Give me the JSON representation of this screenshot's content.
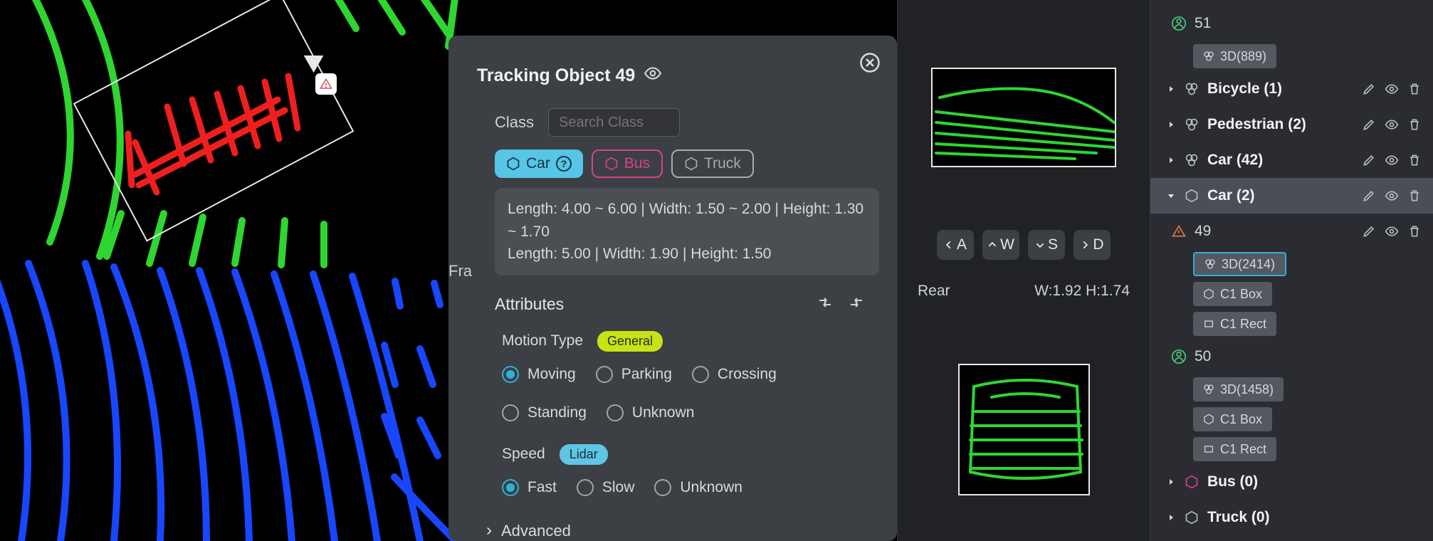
{
  "panel": {
    "title": "Tracking Object 49",
    "class_label": "Class",
    "search_placeholder": "Search Class",
    "classes": {
      "car": "Car",
      "bus": "Bus",
      "truck": "Truck"
    },
    "tooltip_line1": "Length: 4.00 ~ 6.00 | Width: 1.50 ~ 2.00 | Height: 1.30 ~ 1.70",
    "tooltip_line2": "Length: 5.00 | Width: 1.90 | Height: 1.50",
    "frame_cut": "Fra",
    "attributes_label": "Attributes",
    "motion": {
      "label": "Motion Type",
      "badge": "General",
      "options": [
        "Moving",
        "Parking",
        "Crossing",
        "Standing",
        "Unknown"
      ],
      "selected": "Moving"
    },
    "speed": {
      "label": "Speed",
      "badge": "Lidar",
      "options": [
        "Fast",
        "Slow",
        "Unknown"
      ],
      "selected": "Fast"
    },
    "advanced_label": "Advanced"
  },
  "nav_keys": [
    "A",
    "W",
    "S",
    "D"
  ],
  "aux": {
    "rear_label": "Rear",
    "rear_dims": "W:1.92 H:1.74"
  },
  "tree": {
    "node51": "51",
    "node51_asset": "3D(889)",
    "bicycle": "Bicycle  (1)",
    "pedestrian": "Pedestrian  (2)",
    "car42": "Car  (42)",
    "car2": "Car  (2)",
    "node49": "49",
    "node49_assets": [
      "3D(2414)",
      "C1 Box",
      "C1 Rect"
    ],
    "node50": "50",
    "node50_assets": [
      "3D(1458)",
      "C1 Box",
      "C1 Rect"
    ],
    "bus": "Bus  (0)",
    "truck": "Truck  (0)"
  }
}
